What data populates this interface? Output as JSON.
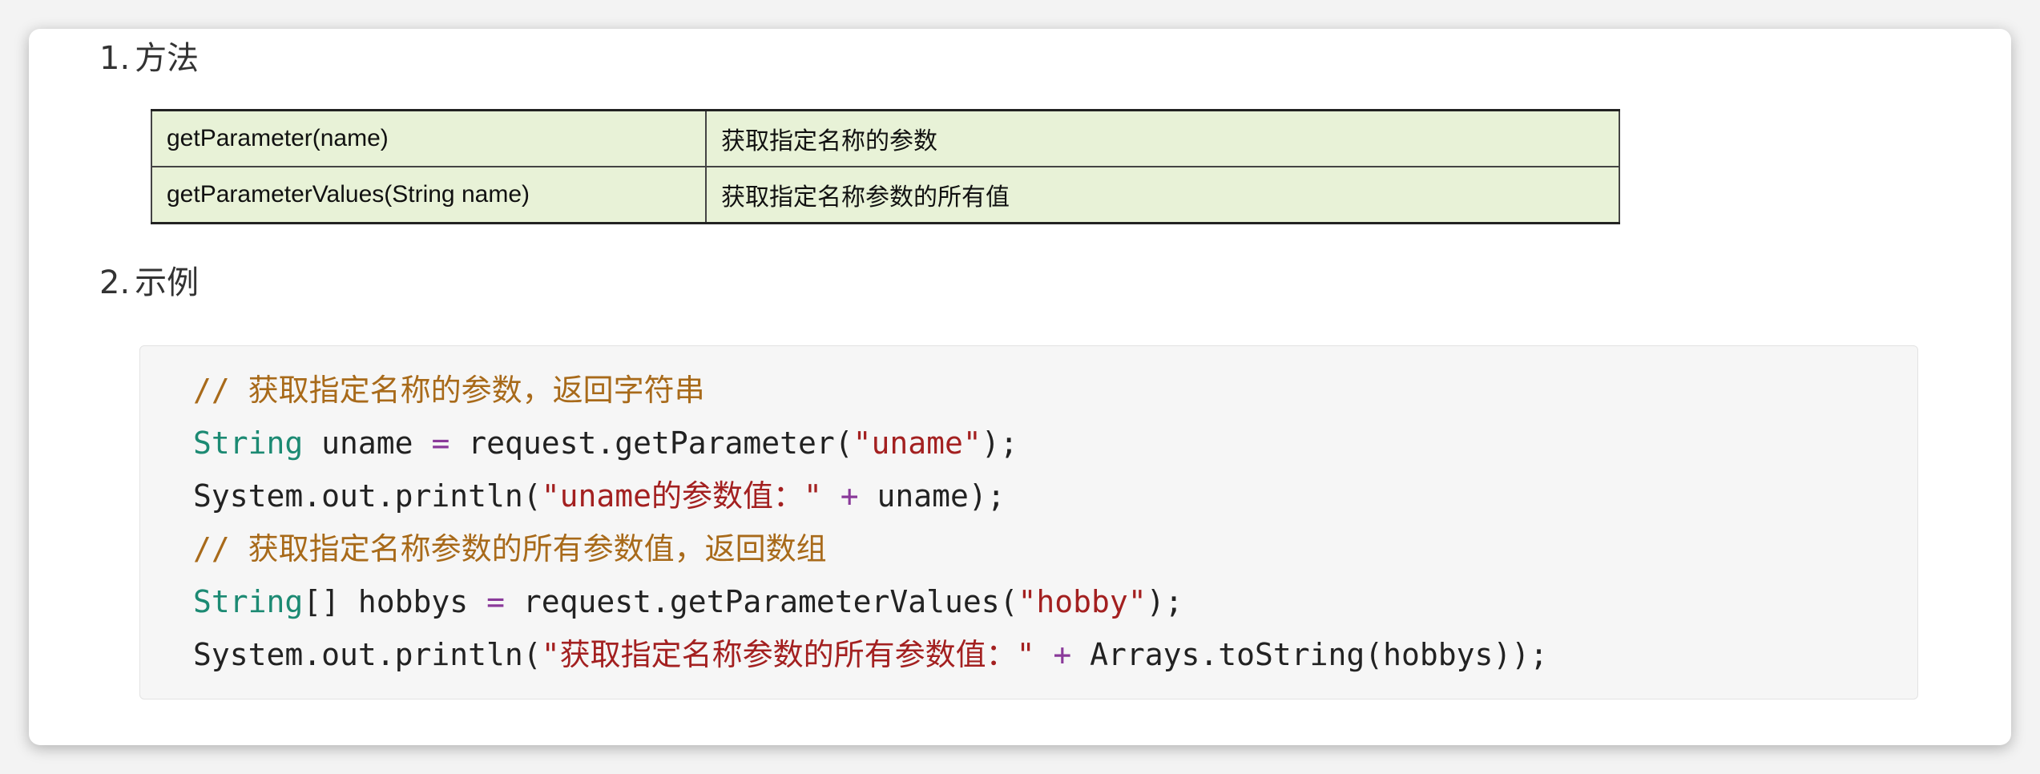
{
  "sections": {
    "method": {
      "number": "1.",
      "title": "方法"
    },
    "example": {
      "number": "2.",
      "title": "示例"
    }
  },
  "methods_table": {
    "rows": [
      {
        "method": "getParameter(name)",
        "description": "获取指定名称的参数"
      },
      {
        "method": "getParameterValues(String name)",
        "description": "获取指定名称参数的所有值"
      }
    ]
  },
  "code": {
    "line1": {
      "comment": "// 获取指定名称的参数，返回字符串"
    },
    "line2": {
      "type": "String",
      "rest1": " uname ",
      "op": "=",
      "rest2": " request.getParameter(",
      "str": "\"uname\"",
      "rest3": ");"
    },
    "line3": {
      "rest1": "System.out.println(",
      "str": "\"uname的参数值：\"",
      "op_pre": " ",
      "op": "+",
      "rest2": " uname);"
    },
    "line4": {
      "comment": "// 获取指定名称参数的所有参数值，返回数组"
    },
    "line5": {
      "type": "String",
      "rest1": "[] hobbys ",
      "op": "=",
      "rest2": " request.getParameterValues(",
      "str": "\"hobby\"",
      "rest3": ");"
    },
    "line6": {
      "rest1": "System.out.println(",
      "str": "\"获取指定名称参数的所有参数值：\"",
      "op_pre": " ",
      "op": "+",
      "rest2": " Arrays.toString(hobbys));"
    }
  },
  "colors": {
    "comment": "#a86a1a",
    "type": "#1c8a73",
    "string": "#a32020",
    "table_bg": "#e8f2d7"
  }
}
